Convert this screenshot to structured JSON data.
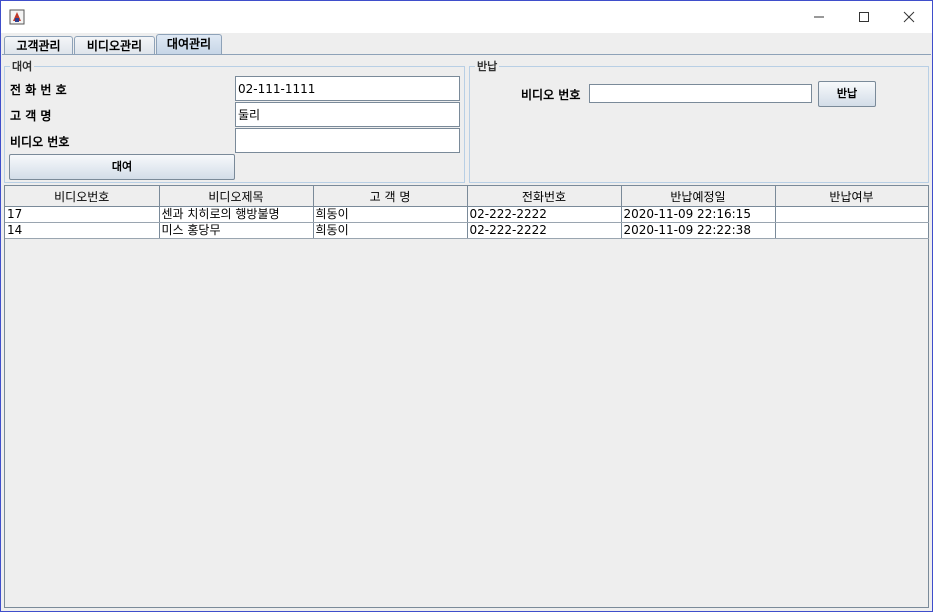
{
  "tabs": [
    "고객관리",
    "비디오관리",
    "대여관리"
  ],
  "rental": {
    "title": "대여",
    "phone_label": "전 화 번 호",
    "phone_value": "02-111-1111",
    "name_label": "고  객  명",
    "name_value": "둘리",
    "video_label": "비디오 번호",
    "video_value": "",
    "button": "대여"
  },
  "return": {
    "title": "반납",
    "video_label": "비디오 번호",
    "video_value": "",
    "button": "반납"
  },
  "table": {
    "headers": [
      "비디오번호",
      "비디오제목",
      "고 객 명",
      "전화번호",
      "반납예정일",
      "반납여부"
    ],
    "rows": [
      [
        "17",
        "센과 치히로의 행방불명",
        "희동이",
        "02-222-2222",
        "2020-11-09 22:16:15",
        ""
      ],
      [
        "14",
        "미스 홍당무",
        "희동이",
        "02-222-2222",
        "2020-11-09 22:22:38",
        ""
      ]
    ]
  }
}
